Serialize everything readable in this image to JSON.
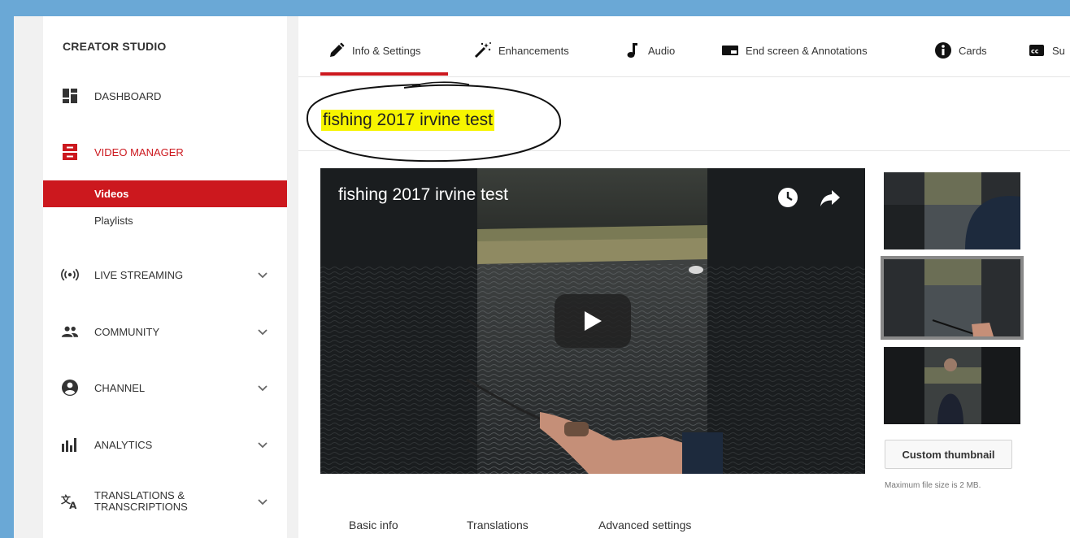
{
  "sidebar": {
    "brand": "CREATOR STUDIO",
    "items": [
      {
        "label": "DASHBOARD"
      },
      {
        "label": "VIDEO MANAGER"
      },
      {
        "label": "LIVE STREAMING"
      },
      {
        "label": "COMMUNITY"
      },
      {
        "label": "CHANNEL"
      },
      {
        "label": "ANALYTICS"
      },
      {
        "label_line1": "TRANSLATIONS &",
        "label_line2": "TRANSCRIPTIONS"
      }
    ],
    "sub_items": [
      {
        "label": "Videos",
        "selected": true
      },
      {
        "label": "Playlists",
        "selected": false
      }
    ]
  },
  "tabs": [
    {
      "label": "Info & Settings",
      "icon": "pencil-icon",
      "active": true
    },
    {
      "label": "Enhancements",
      "icon": "magic-wand-icon"
    },
    {
      "label": "Audio",
      "icon": "music-note-icon"
    },
    {
      "label": "End screen & Annotations",
      "icon": "end-screen-icon"
    },
    {
      "label": "Cards",
      "icon": "info-icon"
    },
    {
      "label": "Su",
      "icon": "closed-captions-icon"
    }
  ],
  "video": {
    "title": "fishing 2017 irvine test",
    "player_title": "fishing 2017 irvine test"
  },
  "thumbnails": {
    "custom_button": "Custom thumbnail",
    "max_size_note": "Maximum file size is 2 MB."
  },
  "bottom_tabs": [
    {
      "label": "Basic info"
    },
    {
      "label": "Translations"
    },
    {
      "label": "Advanced settings"
    }
  ],
  "colors": {
    "accent": "#cc181e",
    "highlight": "#f7f500",
    "background": "#6aa8d6"
  }
}
